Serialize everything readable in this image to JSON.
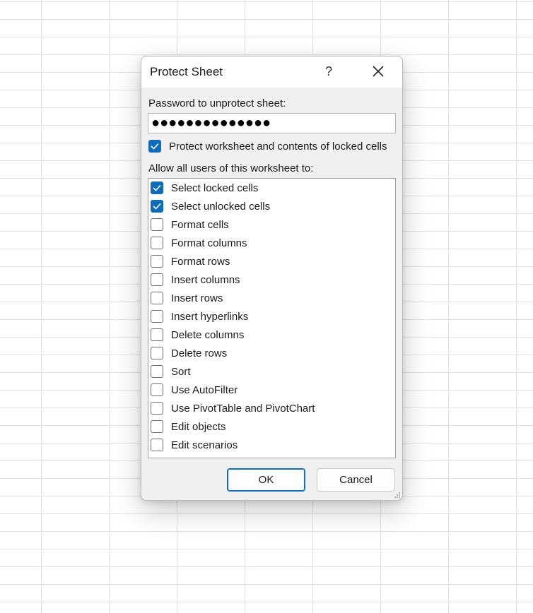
{
  "dialog": {
    "title": "Protect Sheet",
    "help_label": "?",
    "password_label": "Password to unprotect sheet:",
    "password_value": "●●●●●●●●●●●●●●",
    "protect_checkbox_label": "Protect worksheet and contents of locked cells",
    "protect_checked": true,
    "allow_label": "Allow all users of this worksheet to:",
    "permissions": [
      {
        "label": "Select locked cells",
        "checked": true
      },
      {
        "label": "Select unlocked cells",
        "checked": true
      },
      {
        "label": "Format cells",
        "checked": false
      },
      {
        "label": "Format columns",
        "checked": false
      },
      {
        "label": "Format rows",
        "checked": false
      },
      {
        "label": "Insert columns",
        "checked": false
      },
      {
        "label": "Insert rows",
        "checked": false
      },
      {
        "label": "Insert hyperlinks",
        "checked": false
      },
      {
        "label": "Delete columns",
        "checked": false
      },
      {
        "label": "Delete rows",
        "checked": false
      },
      {
        "label": "Sort",
        "checked": false
      },
      {
        "label": "Use AutoFilter",
        "checked": false
      },
      {
        "label": "Use PivotTable and PivotChart",
        "checked": false
      },
      {
        "label": "Edit objects",
        "checked": false
      },
      {
        "label": "Edit scenarios",
        "checked": false
      }
    ],
    "ok_label": "OK",
    "cancel_label": "Cancel"
  },
  "icons": {
    "close": "close-icon",
    "check": "checkmark-icon",
    "resize": "resize-grip-icon"
  },
  "colors": {
    "accent": "#0f6cbd",
    "dialog_bg": "#f0f0f0",
    "gridline": "#e2e2e2"
  }
}
